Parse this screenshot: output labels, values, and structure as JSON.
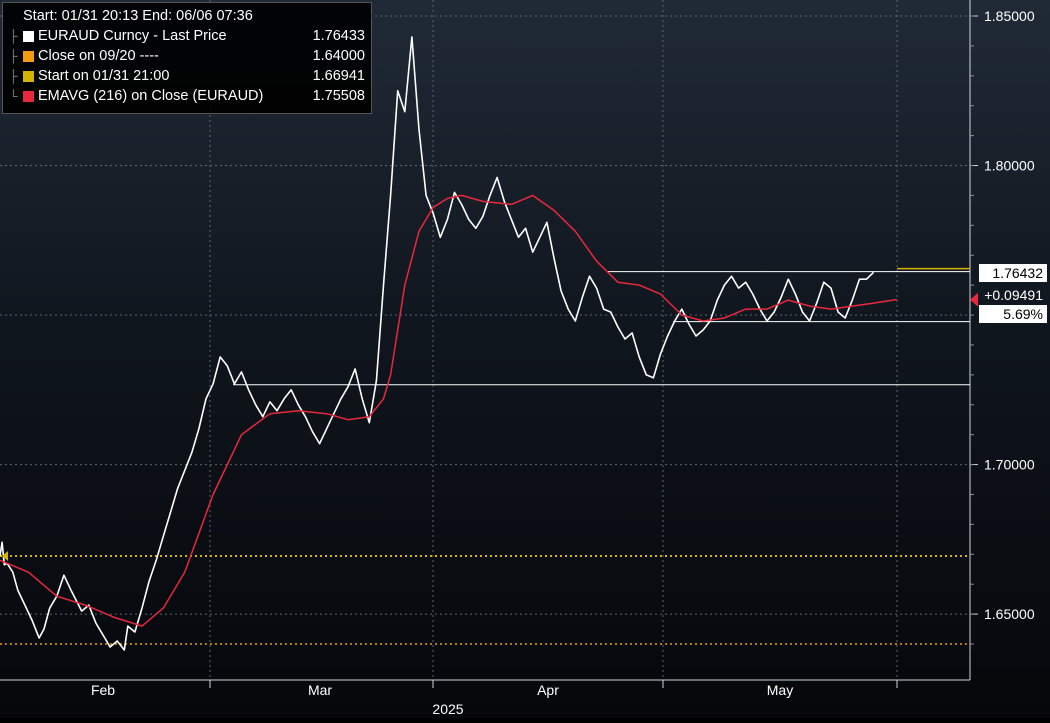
{
  "header": {
    "range_text": "Start: 01/31 20:13 End: 06/06 07:36"
  },
  "legend": [
    {
      "label": "EURAUD Curncy - Last Price",
      "value": "1.76433",
      "color": "#ffffff"
    },
    {
      "label": "Close on 09/20 ----",
      "value": "1.64000",
      "color": "#f39c12"
    },
    {
      "label": "Start on 01/31 21:00",
      "value": "1.66941",
      "color": "#d4b400"
    },
    {
      "label": "EMAVG (216)  on Close (EURAUD)",
      "value": "1.75508",
      "color": "#e8283c"
    }
  ],
  "tags": {
    "last": "1.76432",
    "change": "+0.09491",
    "pct": "5.69%"
  },
  "chart_data": {
    "type": "line",
    "x_tick_labels": [
      "Feb",
      "Mar",
      "Apr",
      "May"
    ],
    "x_year_label": "2025",
    "y_tick_labels": [
      "1.85000",
      "1.80000",
      "1.70000",
      "1.65000"
    ],
    "ylim": [
      1.634,
      1.855
    ],
    "grid": true,
    "colors": {
      "price": "#ffffff",
      "ema": "#e8283c",
      "start": "#d4b400",
      "close": "#f39c12"
    },
    "reference_lines": {
      "start": 1.66941,
      "close": 1.64
    },
    "horizontal_levels": [
      1.7267,
      1.7478,
      1.7645
    ],
    "series": [
      {
        "name": "EURAUD Curncy - Last Price",
        "t": [
          0,
          0.3,
          0.6,
          1,
          1.8,
          2.5,
          3.5,
          4.5,
          5.5,
          6.2,
          7,
          8,
          9,
          10,
          11.5,
          12.5,
          13.5,
          14.5,
          15.5,
          16.5,
          17.5,
          18,
          19,
          20,
          21,
          22,
          23,
          24,
          25,
          26,
          27,
          28,
          29,
          30,
          31,
          32,
          33,
          34,
          35,
          36,
          37,
          38,
          39,
          40,
          41,
          42,
          43,
          44,
          45,
          46,
          47,
          48,
          49,
          50,
          51,
          52,
          53,
          54,
          55,
          56,
          57,
          58,
          59,
          60,
          61,
          62,
          63,
          64,
          65,
          66,
          67,
          68,
          69,
          70,
          71,
          72,
          73,
          74,
          75,
          76,
          77,
          78,
          79,
          80,
          81,
          82,
          83,
          84,
          85,
          86,
          87,
          88,
          89,
          90,
          91,
          92,
          93,
          94,
          95,
          96,
          97,
          98,
          99,
          100,
          101,
          102,
          103,
          104,
          105,
          106,
          107,
          108,
          109,
          110,
          111,
          112,
          113,
          114,
          115,
          116,
          117,
          118,
          119,
          120,
          121,
          122,
          123,
          124,
          125,
          126,
          126.3
        ],
        "values": [
          1.6694,
          1.674,
          1.6665,
          1.667,
          1.664,
          1.658,
          1.653,
          1.648,
          1.642,
          1.645,
          1.652,
          1.656,
          1.663,
          1.658,
          1.651,
          1.653,
          1.647,
          1.643,
          1.639,
          1.641,
          1.638,
          1.646,
          1.644,
          1.652,
          1.661,
          1.668,
          1.676,
          1.684,
          1.692,
          1.698,
          1.704,
          1.712,
          1.722,
          1.727,
          1.736,
          1.733,
          1.727,
          1.731,
          1.725,
          1.72,
          1.716,
          1.721,
          1.718,
          1.722,
          1.725,
          1.72,
          1.716,
          1.711,
          1.707,
          1.712,
          1.717,
          1.722,
          1.726,
          1.732,
          1.722,
          1.714,
          1.728,
          1.76,
          1.79,
          1.825,
          1.818,
          1.843,
          1.812,
          1.79,
          1.784,
          1.776,
          1.782,
          1.791,
          1.787,
          1.782,
          1.779,
          1.783,
          1.79,
          1.796,
          1.788,
          1.782,
          1.776,
          1.779,
          1.771,
          1.776,
          1.781,
          1.769,
          1.758,
          1.752,
          1.748,
          1.756,
          1.763,
          1.759,
          1.752,
          1.751,
          1.746,
          1.742,
          1.744,
          1.736,
          1.73,
          1.729,
          1.737,
          1.743,
          1.748,
          1.752,
          1.747,
          1.743,
          1.745,
          1.748,
          1.755,
          1.76,
          1.763,
          1.759,
          1.761,
          1.757,
          1.752,
          1.748,
          1.751,
          1.756,
          1.762,
          1.757,
          1.751,
          1.748,
          1.754,
          1.761,
          1.759,
          1.751,
          1.749,
          1.755,
          1.762,
          1.762,
          1.7643
        ]
      },
      {
        "name": "EMAVG (216)  on Close (EURAUD)",
        "t": [
          0,
          4,
          8,
          12,
          16,
          20,
          23,
          26,
          30,
          34,
          38,
          42,
          46,
          49,
          52,
          54,
          55,
          57,
          59,
          61,
          63,
          65,
          68,
          72,
          75,
          78,
          81,
          84,
          87,
          90,
          93,
          96,
          99,
          102,
          105,
          108,
          111,
          114,
          117,
          120,
          123,
          126,
          126.3
        ],
        "values": [
          1.668,
          1.664,
          1.656,
          1.653,
          1.649,
          1.646,
          1.652,
          1.664,
          1.69,
          1.71,
          1.717,
          1.718,
          1.717,
          1.715,
          1.716,
          1.722,
          1.73,
          1.76,
          1.778,
          1.786,
          1.789,
          1.79,
          1.788,
          1.787,
          1.79,
          1.785,
          1.778,
          1.768,
          1.761,
          1.76,
          1.757,
          1.75,
          1.748,
          1.749,
          1.752,
          1.752,
          1.755,
          1.753,
          1.752,
          1.753,
          1.754,
          1.7551,
          1.7551
        ]
      }
    ]
  }
}
